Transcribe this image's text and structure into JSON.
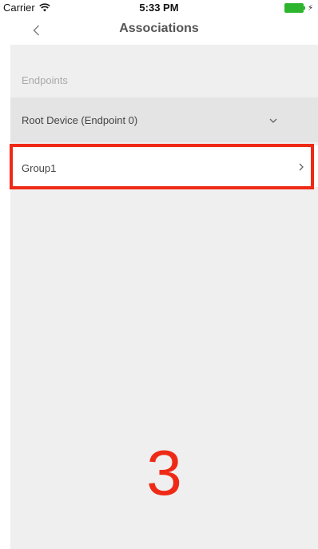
{
  "status_bar": {
    "carrier": "Carrier",
    "time": "5:33 PM"
  },
  "nav": {
    "title": "Associations"
  },
  "endpoints": {
    "section_header": "Endpoints",
    "selected_endpoint": "Root Device (Endpoint 0)"
  },
  "groups": [
    {
      "label": "Group1"
    }
  ],
  "annotation": {
    "step_number": "3",
    "color": "#ee2a16"
  },
  "colors": {
    "content_background": "#efefef",
    "endpoint_row_background": "#e4e4e4",
    "battery": "#2db52d"
  }
}
